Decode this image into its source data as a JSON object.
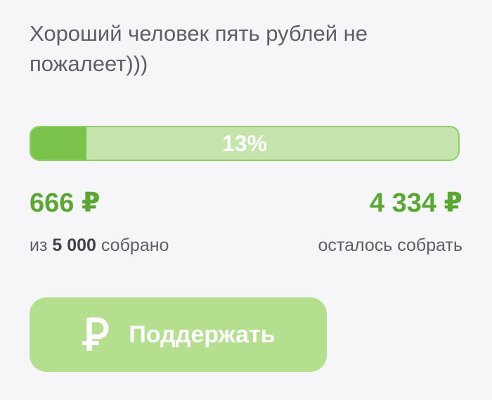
{
  "campaign": {
    "description": "Хороший человек пять рублей не пожалеет)))"
  },
  "progress": {
    "percent": 13,
    "label": "13%"
  },
  "raised": {
    "amount": "666 ₽",
    "prefix": "из",
    "goal": "5 000",
    "suffix": "собрано"
  },
  "remaining": {
    "amount": "4 334 ₽",
    "label": "осталось собрать"
  },
  "support_button": {
    "label": "Поддержать",
    "icon": "ruble-icon"
  },
  "colors": {
    "accent_green": "#5aa832",
    "progress_fill": "#7bc24a",
    "progress_track": "#c5e4ac",
    "button_bg": "#b3df8f",
    "text_gray": "#5c5f66"
  }
}
